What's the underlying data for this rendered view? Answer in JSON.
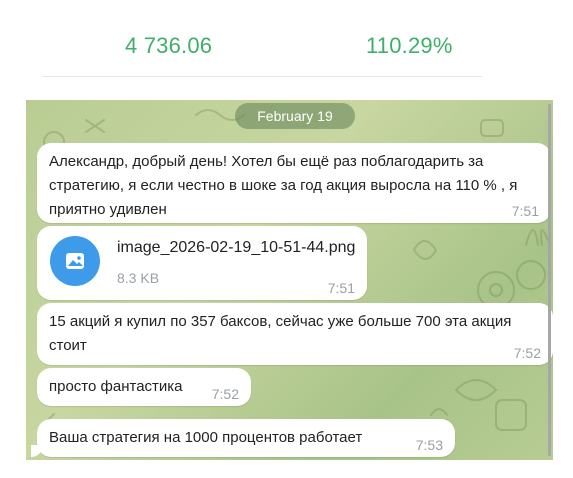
{
  "stats": {
    "value1": "4 736.06",
    "value2": "110.29%"
  },
  "chat": {
    "date_label": "February 19",
    "messages": [
      {
        "text": "Александр, добрый день! Хотел бы ещё раз поблагодарить за стратегию, я если честно в шоке за год акция выросла на 110 % , я приятно удивлен",
        "time": "7:51"
      },
      {
        "file_name": "image_2026-02-19_10-51-44.png",
        "file_size": "8.3 KB",
        "time": "7:51",
        "icon": "image-icon"
      },
      {
        "text": "15 акций я купил по 357 баксов, сейчас уже больше 700 эта акция стоит",
        "time": "7:52"
      },
      {
        "text": "просто фантастика",
        "time": "7:52"
      },
      {
        "text": "Ваша стратегия на 1000 процентов работает",
        "time": "7:53"
      }
    ]
  },
  "colors": {
    "stat_green": "#3fae6a",
    "chat_background": "#bccf96",
    "file_icon_blue": "#3d9be9",
    "time_gray": "#9aa0a6"
  }
}
